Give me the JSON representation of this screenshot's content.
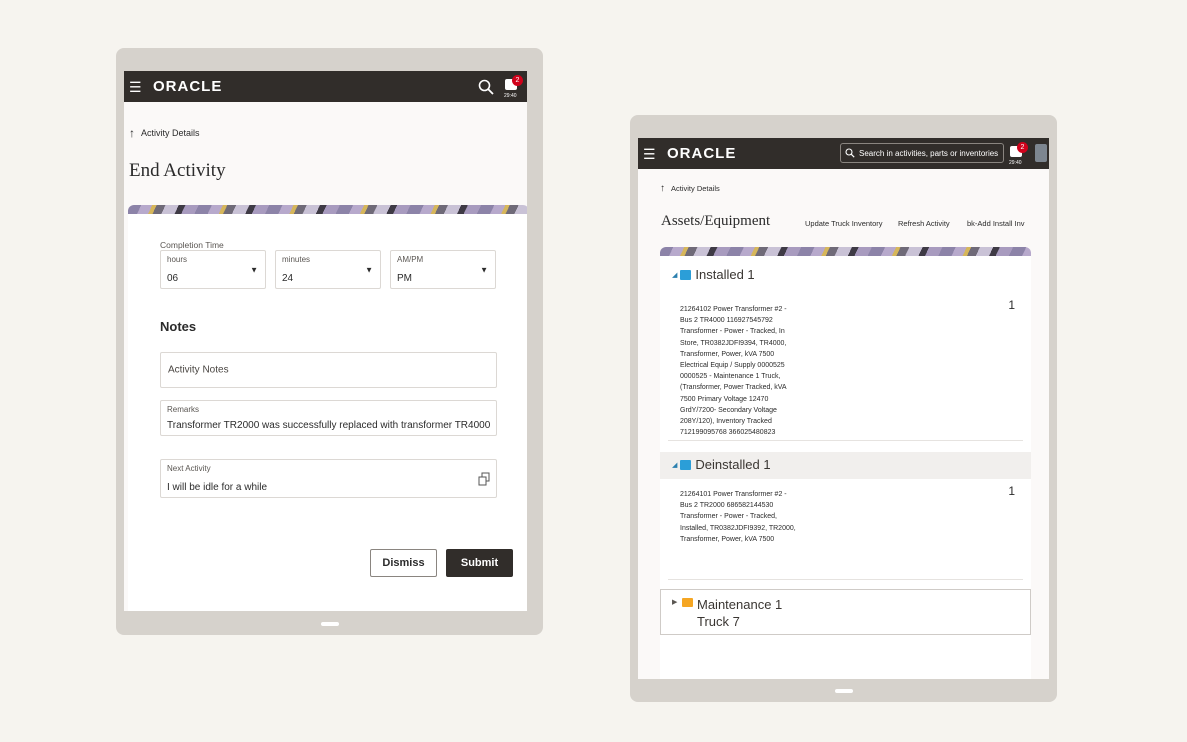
{
  "left": {
    "app": {
      "logo": "ORACLE",
      "notification_count": "2",
      "time": "29:40"
    },
    "back_link": "Activity Details",
    "title": "End Activity",
    "completion_time": {
      "label": "Completion Time",
      "hours": {
        "label": "hours",
        "value": "06"
      },
      "minutes": {
        "label": "minutes",
        "value": "24"
      },
      "ampm": {
        "label": "AM/PM",
        "value": "PM"
      }
    },
    "notes_heading": "Notes",
    "activity_notes_placeholder": "Activity Notes",
    "remarks": {
      "label": "Remarks",
      "value": "Transformer TR2000 was successfully replaced with transformer TR4000"
    },
    "next_activity": {
      "label": "Next Activity",
      "value": "I will be idle for a while"
    },
    "buttons": {
      "dismiss": "Dismiss",
      "submit": "Submit"
    }
  },
  "right": {
    "app": {
      "logo": "ORACLE",
      "search_placeholder": "Search in activities, parts or inventories",
      "notification_count": "2",
      "time": "29:40"
    },
    "back_link": "Activity Details",
    "title": "Assets/Equipment",
    "actions": {
      "update_truck": "Update Truck Inventory",
      "refresh": "Refresh Activity",
      "add_install": "bk-Add Install Inv"
    },
    "installed": {
      "title": "Installed 1",
      "item": "21264102 Power Transformer #2 - Bus 2 TR4000 116927545792 Transformer - Power - Tracked, In Store, TR0382JDFI9394, TR4000, Transformer, Power, kVA 7500 Electrical Equip / Supply 0000525 0000525 - Maintenance 1 Truck, (Transformer, Power Tracked, kVA 7500 Primary Voltage 12470 GrdY/7200- Secondary Voltage 208Y/120), Inventory Tracked 712199095768 366025480823",
      "qty": "1"
    },
    "deinstalled": {
      "title": "Deinstalled 1",
      "item": "21264101 Power Transformer #2 - Bus 2 TR2000 686582144530 Transformer - Power - Tracked, Installed, TR0382JDFI9392, TR2000, Transformer, Power, kVA 7500",
      "qty": "1"
    },
    "maintenance": {
      "title_line1": "Maintenance 1",
      "title_line2": "Truck 7"
    }
  },
  "colors": {
    "appbar": "#312d2a",
    "primary_button": "#312d2a",
    "badge": "#d0021b",
    "accent": "#2b7fae"
  }
}
